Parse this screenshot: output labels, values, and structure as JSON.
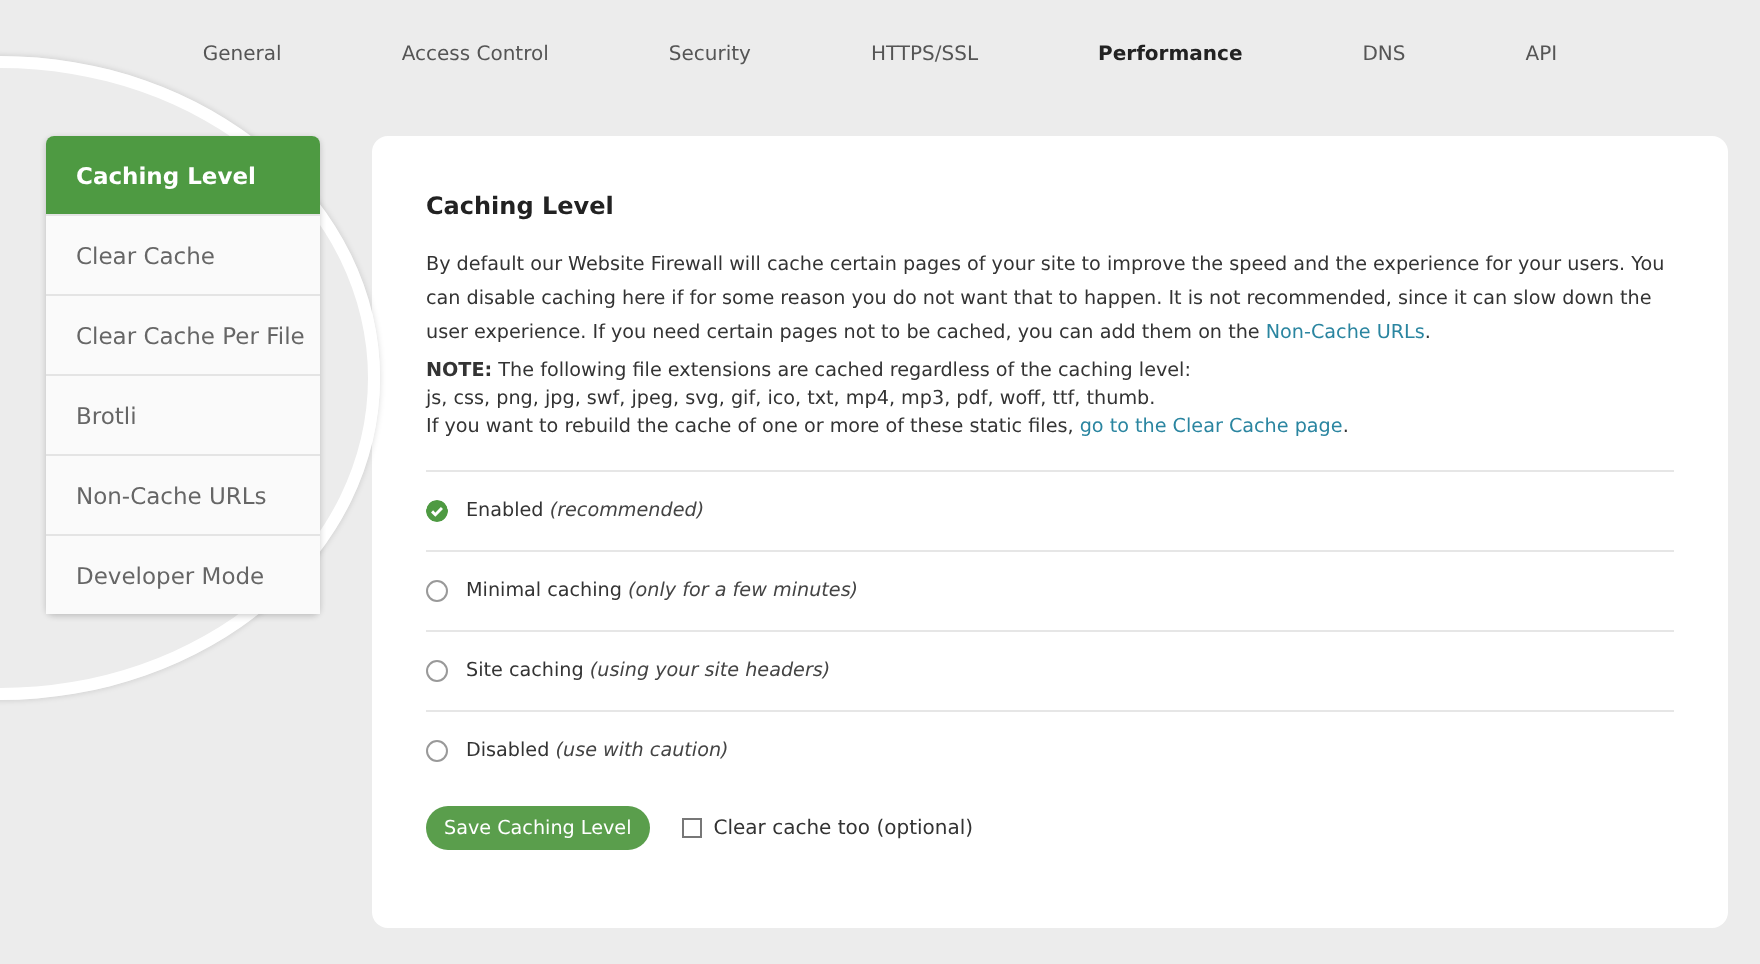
{
  "tabs": [
    {
      "label": "General",
      "selected": false
    },
    {
      "label": "Access Control",
      "selected": false
    },
    {
      "label": "Security",
      "selected": false
    },
    {
      "label": "HTTPS/SSL",
      "selected": false
    },
    {
      "label": "Performance",
      "selected": true
    },
    {
      "label": "DNS",
      "selected": false
    },
    {
      "label": "API",
      "selected": false
    }
  ],
  "sidebar": {
    "items": [
      {
        "label": "Caching Level",
        "selected": true
      },
      {
        "label": "Clear Cache",
        "selected": false
      },
      {
        "label": "Clear Cache Per File",
        "selected": false
      },
      {
        "label": "Brotli",
        "selected": false
      },
      {
        "label": "Non-Cache URLs",
        "selected": false
      },
      {
        "label": "Developer Mode",
        "selected": false
      }
    ]
  },
  "panel": {
    "title": "Caching Level",
    "intro": {
      "text": "By default our Website Firewall will cache certain pages of your site to improve the speed and the experience for your users. You can disable caching here if for some reason you do not want that to happen. It is not recommended, since it can slow down the user experience. If you need certain pages not to be cached, you can add them on the",
      "link": "Non-Cache URLs",
      "after": "."
    },
    "note": "**NOTE:** The following file extensions are cached regardless of the caching level:",
    "extensions": "js, css, png, jpg, swf, jpeg, svg, gif, ico, txt, mp4, mp3, pdf, woff, ttf, thumb.",
    "rebuild": {
      "text": "If you want to rebuild the cache of one or more of these static files,",
      "link": "go to the Clear Cache page",
      "after": "."
    },
    "options": [
      {
        "label": "Enabled",
        "hint": "(recommended)",
        "selected": true
      },
      {
        "label": "Minimal caching",
        "hint": "(only for a few minutes)",
        "selected": false
      },
      {
        "label": "Site caching",
        "hint": "(using your site headers)",
        "selected": false
      },
      {
        "label": "Disabled",
        "hint": "(use with caution)",
        "selected": false
      }
    ],
    "save_button": "Save Caching Level",
    "clear_checkbox": {
      "label": "Clear cache too (optional)",
      "checked": false
    }
  }
}
